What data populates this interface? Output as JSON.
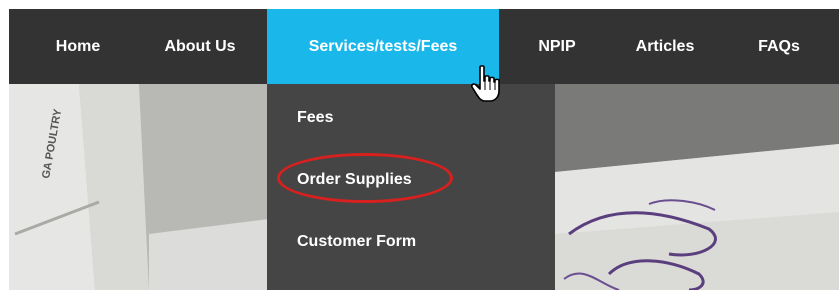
{
  "nav": {
    "items": [
      {
        "label": "Home"
      },
      {
        "label": "About Us"
      },
      {
        "label": "Services/tests/Fees"
      },
      {
        "label": "NPIP"
      },
      {
        "label": "Articles"
      },
      {
        "label": "FAQs"
      }
    ],
    "active_color": "#1ab7ea",
    "bar_color": "#333333"
  },
  "dropdown": {
    "items": [
      {
        "label": "Fees"
      },
      {
        "label": "Order Supplies"
      },
      {
        "label": "Customer Form"
      }
    ],
    "background": "#454545",
    "highlight_color": "#d8201f"
  },
  "cursor": {
    "icon": "hand-pointer-icon"
  }
}
